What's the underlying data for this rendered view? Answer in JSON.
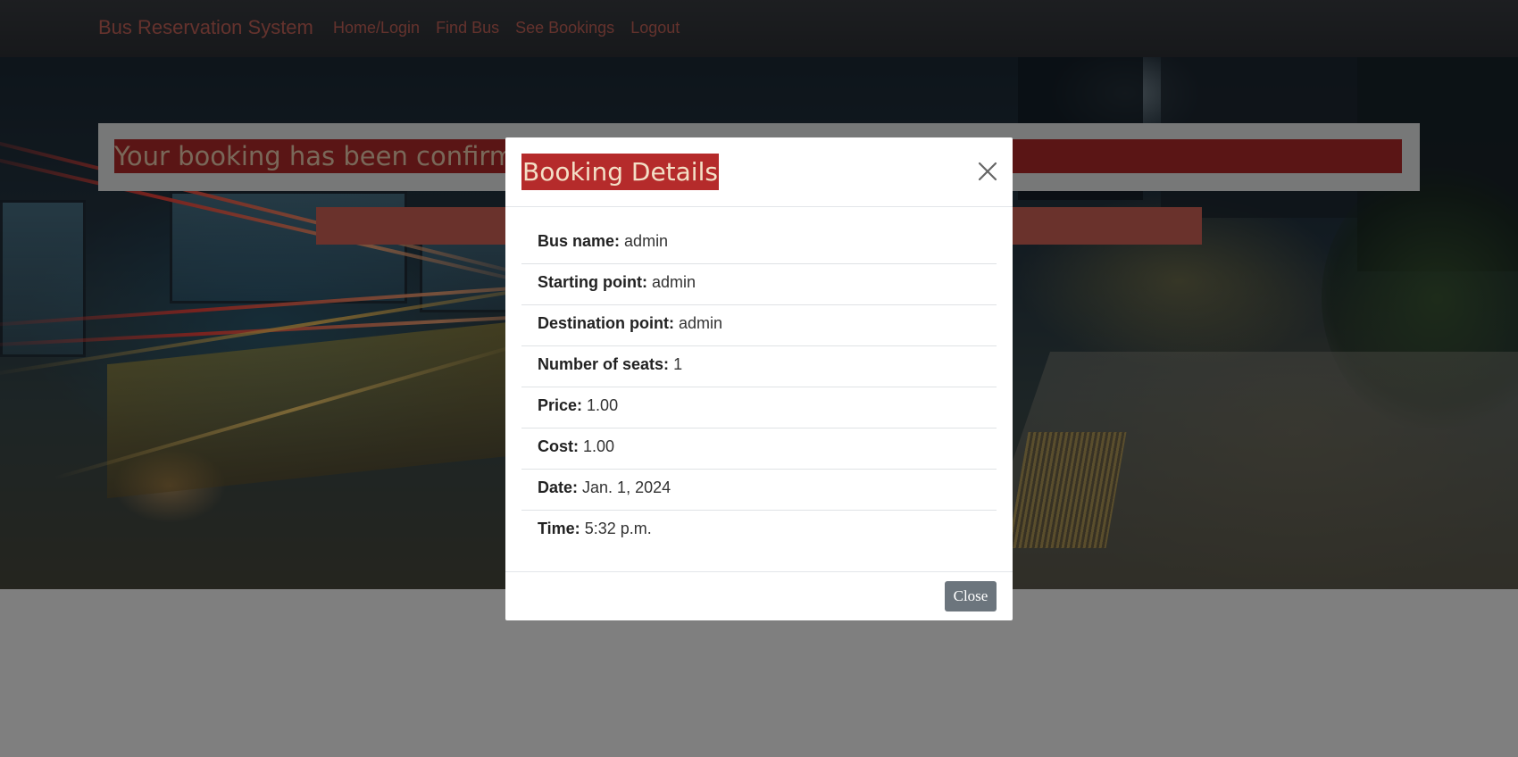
{
  "navbar": {
    "brand": "Bus Reservation System",
    "links": [
      "Home/Login",
      "Find Bus",
      "See Bookings",
      "Logout"
    ]
  },
  "page": {
    "alert_text": "Your booking has been confirmed"
  },
  "modal": {
    "title": "Booking Details",
    "close_icon": "close-icon",
    "details": [
      {
        "label": "Bus name:",
        "value": "admin"
      },
      {
        "label": "Starting point:",
        "value": "admin"
      },
      {
        "label": "Destination point:",
        "value": "admin"
      },
      {
        "label": "Number of seats:",
        "value": "1"
      },
      {
        "label": "Price:",
        "value": "1.00"
      },
      {
        "label": "Cost:",
        "value": "1.00"
      },
      {
        "label": "Date:",
        "value": "Jan. 1, 2024"
      },
      {
        "label": "Time:",
        "value": "5:32 p.m."
      }
    ],
    "close_label": "Close"
  },
  "colors": {
    "accent": "#c9655a",
    "title_highlight": "#b52b2b",
    "close_button": "#6c757d"
  }
}
